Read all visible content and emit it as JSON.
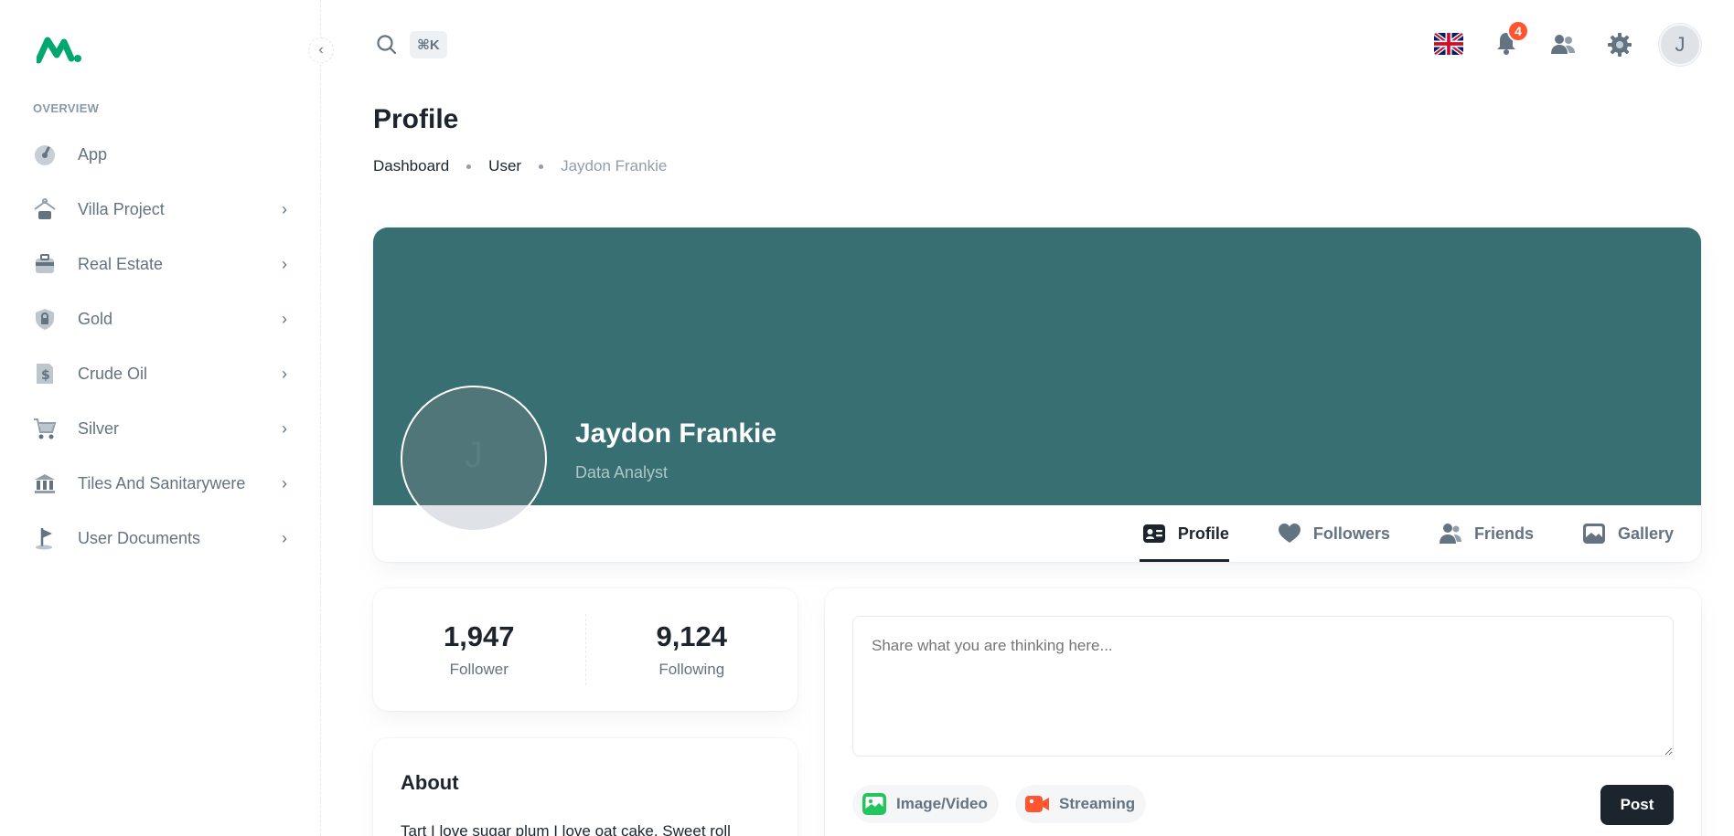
{
  "sidebar": {
    "section_label": "OVERVIEW",
    "collapse_glyph": "‹",
    "items": [
      {
        "label": "App",
        "icon": "dashboard-gauge-icon",
        "has_children": false
      },
      {
        "label": "Villa Project",
        "icon": "hanger-bag-icon",
        "has_children": true
      },
      {
        "label": "Real Estate",
        "icon": "briefcase-icon",
        "has_children": true
      },
      {
        "label": "Gold",
        "icon": "shield-lock-icon",
        "has_children": true
      },
      {
        "label": "Crude Oil",
        "icon": "invoice-dollar-icon",
        "has_children": true
      },
      {
        "label": "Silver",
        "icon": "shopping-cart-icon",
        "has_children": true
      },
      {
        "label": "Tiles And Sanitarywere",
        "icon": "bank-icon",
        "has_children": true
      },
      {
        "label": "User Documents",
        "icon": "flag-tour-icon",
        "has_children": true
      }
    ],
    "chevron_glyph": "›"
  },
  "header": {
    "shortcut": "⌘K",
    "notification_count": "4",
    "avatar_initial": "J"
  },
  "page": {
    "title": "Profile",
    "breadcrumb": [
      "Dashboard",
      "User",
      "Jaydon Frankie"
    ]
  },
  "profile": {
    "name": "Jaydon Frankie",
    "role": "Data Analyst",
    "avatar_initial": "J",
    "cover_color": "#386f72",
    "tabs": [
      {
        "label": "Profile",
        "icon": "id-card-icon",
        "active": true
      },
      {
        "label": "Followers",
        "icon": "heart-icon",
        "active": false
      },
      {
        "label": "Friends",
        "icon": "users-icon",
        "active": false
      },
      {
        "label": "Gallery",
        "icon": "gallery-icon",
        "active": false
      }
    ]
  },
  "stats": {
    "follower_value": "1,947",
    "follower_label": "Follower",
    "following_value": "9,124",
    "following_label": "Following"
  },
  "about": {
    "title": "About",
    "text": "Tart I love sugar plum I love oat cake. Sweet roll"
  },
  "post": {
    "placeholder": "Share what you are thinking here...",
    "image_video_label": "Image/Video",
    "streaming_label": "Streaming",
    "post_label": "Post"
  },
  "colors": {
    "accent_dark": "#1c252e",
    "badge": "#ff5630",
    "logo_green": "#00a76f",
    "image_icon_green": "#22c55e",
    "streaming_icon_red": "#ff5630"
  }
}
